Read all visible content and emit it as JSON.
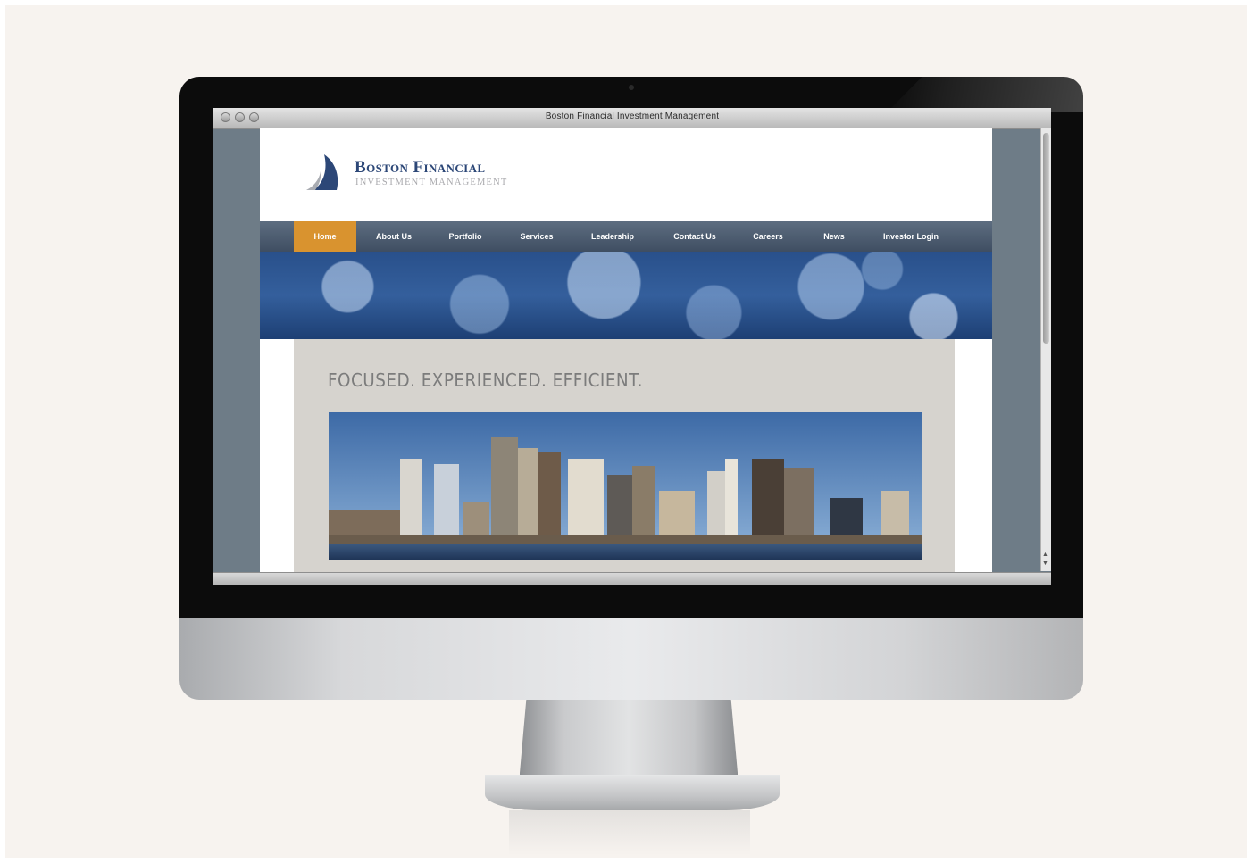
{
  "window": {
    "title": "Boston Financial Investment Management"
  },
  "site": {
    "logo_title": "Boston Financial",
    "logo_subtitle": "INVESTMENT MANAGEMENT",
    "nav": [
      {
        "label": "Home",
        "active": true
      },
      {
        "label": "About Us",
        "active": false
      },
      {
        "label": "Portfolio",
        "active": false
      },
      {
        "label": "Services",
        "active": false
      },
      {
        "label": "Leadership",
        "active": false
      },
      {
        "label": "Contact Us",
        "active": false
      },
      {
        "label": "Careers",
        "active": false
      },
      {
        "label": "News",
        "active": false
      },
      {
        "label": "Investor Login",
        "active": false
      }
    ],
    "tagline": "FOCUSED.  EXPERIENCED.  EFFICIENT."
  },
  "colors": {
    "brand_navy": "#2c4777",
    "nav_active": "#d9932f",
    "nav_bg": "#4a5a6e",
    "content_bg": "#d6d3ce"
  },
  "icons": {
    "logo": "sailboat-logo-icon",
    "scroll_up": "arrow-up-icon",
    "scroll_down": "arrow-down-icon"
  }
}
